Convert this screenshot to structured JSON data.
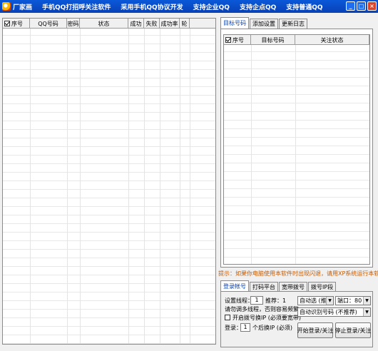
{
  "title_bar": {
    "items": [
      "厂家画",
      "手机QQ打招呼关注软件",
      "采用手机QQ协议开发",
      "支持企业QQ",
      "支持企点QQ",
      "支持普通QQ"
    ],
    "minimize": "_",
    "maximize": "□",
    "close": "×"
  },
  "main_table": {
    "columns": [
      "序号",
      "QQ号码",
      "密码",
      "状态",
      "成功",
      "失败",
      "成功率",
      "轮"
    ],
    "select_all_checked": true
  },
  "right_tabs": [
    "目标号码",
    "添加设置",
    "更新日志"
  ],
  "right_tabs_active": 0,
  "target_table": {
    "columns": [
      "序号",
      "目标号码",
      "关注状态"
    ],
    "select_all_checked": true
  },
  "hint": "提示：如果你电脑使用本软件时出现闪退，请用XP系统运行本软件",
  "bottom_tabs": [
    "登录帐号",
    "打码平台",
    "宽带拨号",
    "拨号IP段"
  ],
  "bottom_tabs_active": 0,
  "settings": {
    "threads_label": "设置线程：",
    "threads_value": "1",
    "recommend": "推荐：1",
    "warning": "请勿调多线程，否则容易频繁",
    "dial_checkbox_label": "开启拨号换IP (必须要宽带)",
    "dial_checked": false,
    "login_prefix": "登录：",
    "login_value": "1",
    "login_suffix": "个后换IP (必须)",
    "server_select": "自动选 (推荐)",
    "port_label": "端口：80",
    "identify_select": "自动识别号码 (不推荐)",
    "start_button": "开始登录/关注",
    "stop_button": "停止登录/关注"
  }
}
